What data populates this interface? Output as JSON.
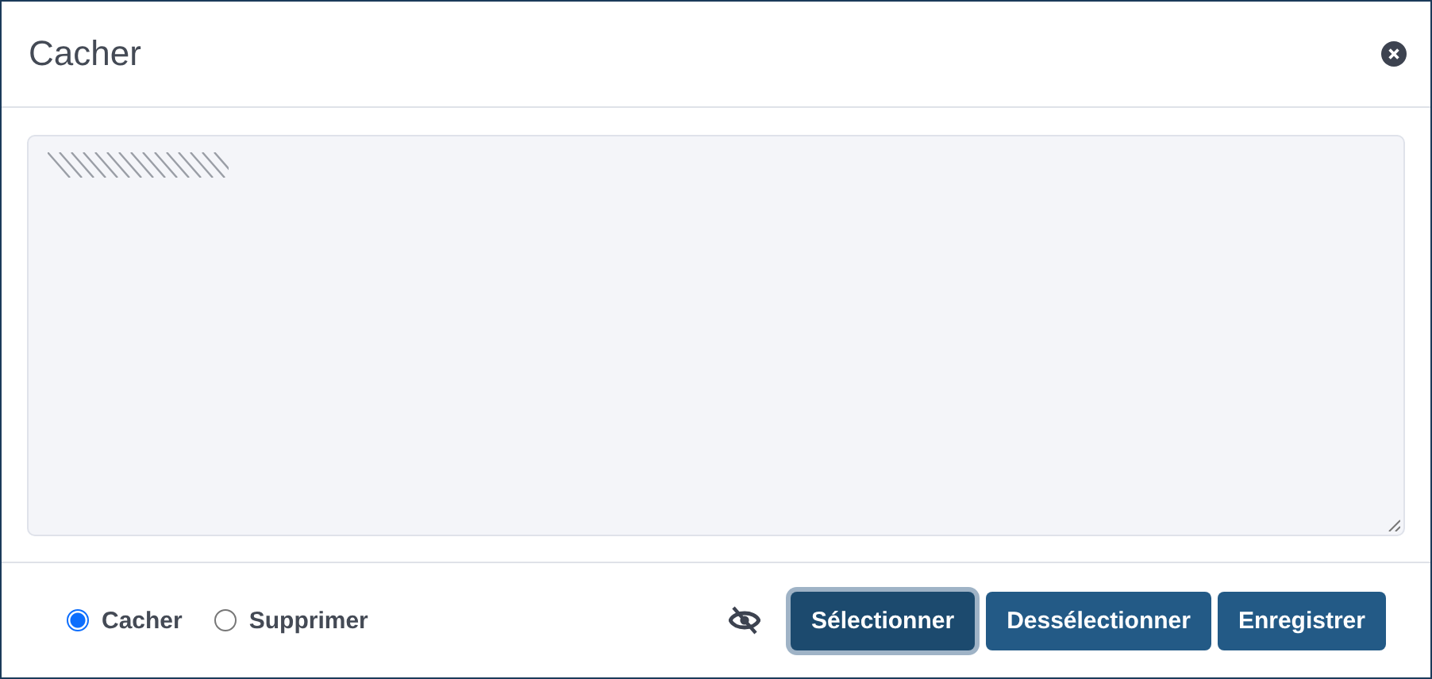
{
  "dialog": {
    "title": "Cacher"
  },
  "options": [
    {
      "label": "Cacher",
      "selected": true
    },
    {
      "label": "Supprimer",
      "selected": false
    }
  ],
  "buttons": [
    {
      "label": "Sélectionner",
      "focused": true
    },
    {
      "label": "Dessélectionner",
      "focused": false
    },
    {
      "label": "Enregistrer",
      "focused": false
    }
  ]
}
